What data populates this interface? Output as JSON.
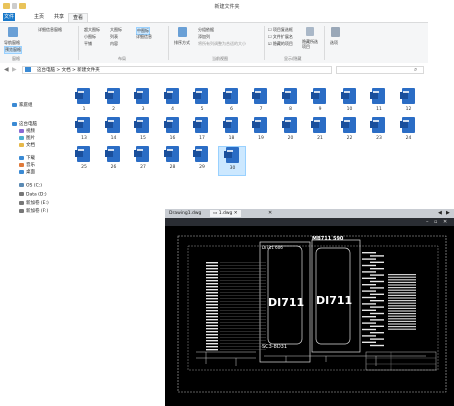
{
  "window": {
    "title": "新建文件夹"
  },
  "ribbon_tabs": [
    "文件",
    "主页",
    "共享",
    "查看"
  ],
  "ribbon": {
    "nav_pane": "导航窗格",
    "preview_pane": "预览窗格",
    "details_pane": "详细信息窗格",
    "layout_items": [
      "超大图标",
      "大图标",
      "中图标",
      "小图标",
      "列表",
      "详细信息",
      "平铺",
      "内容"
    ],
    "sort_by": "排序方式",
    "group_by": "分组依据",
    "add_columns": "添加列",
    "fit_columns": "将所有列调整为合适的大小",
    "item_checkboxes": "项目复选框",
    "file_extensions": "文件扩展名",
    "hidden_items": "隐藏的项目",
    "hide_selected": "隐藏所选项目",
    "options": "选项",
    "group_labels": [
      "窗格",
      "布局",
      "当前视图",
      "显示/隐藏"
    ]
  },
  "address": {
    "path": "这台电脑 > 文档 > 新建文件夹"
  },
  "sidebar": [
    {
      "label": "家庭组",
      "color": "#3a8ad4"
    },
    {
      "label": "这台电脑",
      "color": "#3a8ad4"
    },
    {
      "label": "视频",
      "color": "#8a6ad4"
    },
    {
      "label": "图片",
      "color": "#4ab0d0"
    },
    {
      "label": "文档",
      "color": "#e6b84a"
    },
    {
      "label": "下载",
      "color": "#3a8ad4"
    },
    {
      "label": "音乐",
      "color": "#e07a3a"
    },
    {
      "label": "桌面",
      "color": "#3a8ad4"
    },
    {
      "label": "OS (C:)",
      "color": "#5a8ab4"
    },
    {
      "label": "Data (D:)",
      "color": "#777777"
    },
    {
      "label": "新加卷 (E:)",
      "color": "#777777"
    },
    {
      "label": "新加卷 (F:)",
      "color": "#777777"
    },
    {
      "label": "CD 驱动器 (H:)",
      "color": "#777777"
    },
    {
      "label": "可移动磁盘 (I:)",
      "color": "#777777"
    }
  ],
  "files": [
    "1",
    "2",
    "3",
    "4",
    "5",
    "6",
    "7",
    "8",
    "9",
    "10",
    "11",
    "12",
    "13",
    "14",
    "15",
    "16",
    "17",
    "18",
    "19",
    "20",
    "21",
    "22",
    "23",
    "24",
    "25",
    "26",
    "27",
    "28",
    "29",
    "30"
  ],
  "selected_file": "30",
  "cad": {
    "tabs": [
      "Drawing1.dwg",
      "1.dwg"
    ],
    "module_left": "DI711",
    "module_right": "DI711",
    "header_left": "DI711 606",
    "header_right": "MB711 590",
    "footer_label": "SC3-8D31"
  }
}
